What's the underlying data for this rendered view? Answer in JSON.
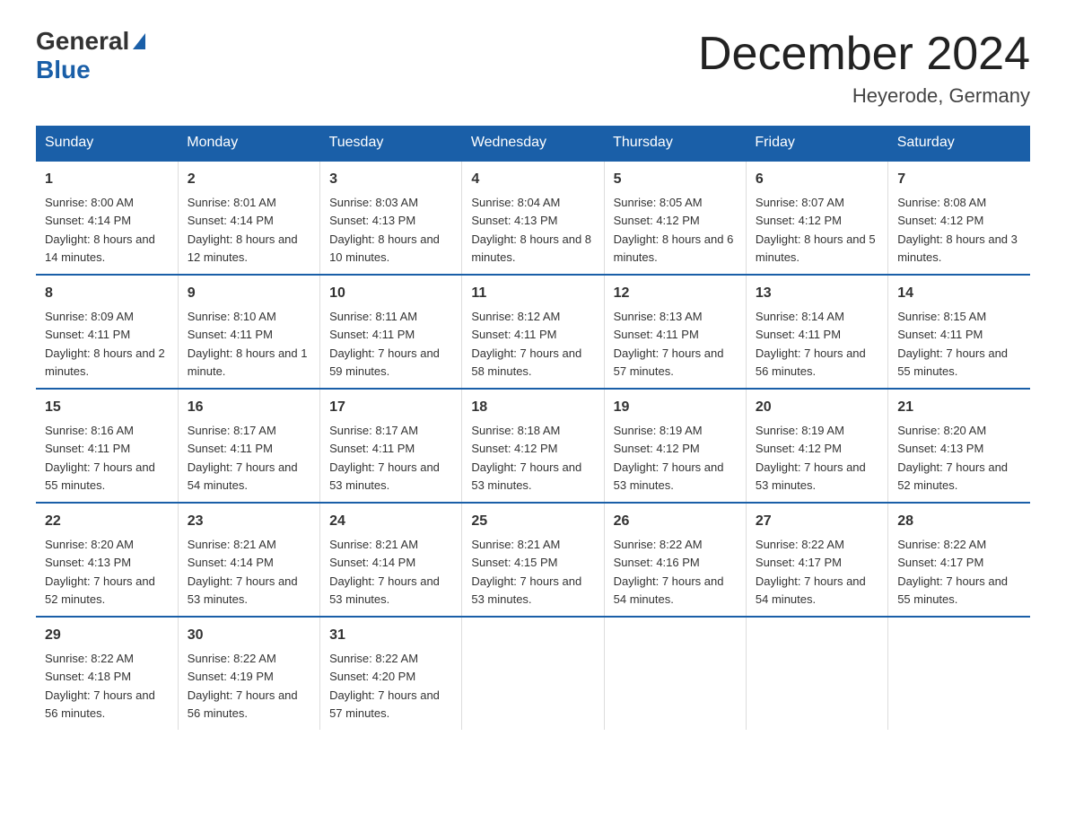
{
  "header": {
    "logo_general": "General",
    "logo_blue": "Blue",
    "main_title": "December 2024",
    "subtitle": "Heyerode, Germany"
  },
  "days_of_week": [
    "Sunday",
    "Monday",
    "Tuesday",
    "Wednesday",
    "Thursday",
    "Friday",
    "Saturday"
  ],
  "weeks": [
    [
      {
        "day": "1",
        "sunrise": "8:00 AM",
        "sunset": "4:14 PM",
        "daylight": "8 hours and 14 minutes."
      },
      {
        "day": "2",
        "sunrise": "8:01 AM",
        "sunset": "4:14 PM",
        "daylight": "8 hours and 12 minutes."
      },
      {
        "day": "3",
        "sunrise": "8:03 AM",
        "sunset": "4:13 PM",
        "daylight": "8 hours and 10 minutes."
      },
      {
        "day": "4",
        "sunrise": "8:04 AM",
        "sunset": "4:13 PM",
        "daylight": "8 hours and 8 minutes."
      },
      {
        "day": "5",
        "sunrise": "8:05 AM",
        "sunset": "4:12 PM",
        "daylight": "8 hours and 6 minutes."
      },
      {
        "day": "6",
        "sunrise": "8:07 AM",
        "sunset": "4:12 PM",
        "daylight": "8 hours and 5 minutes."
      },
      {
        "day": "7",
        "sunrise": "8:08 AM",
        "sunset": "4:12 PM",
        "daylight": "8 hours and 3 minutes."
      }
    ],
    [
      {
        "day": "8",
        "sunrise": "8:09 AM",
        "sunset": "4:11 PM",
        "daylight": "8 hours and 2 minutes."
      },
      {
        "day": "9",
        "sunrise": "8:10 AM",
        "sunset": "4:11 PM",
        "daylight": "8 hours and 1 minute."
      },
      {
        "day": "10",
        "sunrise": "8:11 AM",
        "sunset": "4:11 PM",
        "daylight": "7 hours and 59 minutes."
      },
      {
        "day": "11",
        "sunrise": "8:12 AM",
        "sunset": "4:11 PM",
        "daylight": "7 hours and 58 minutes."
      },
      {
        "day": "12",
        "sunrise": "8:13 AM",
        "sunset": "4:11 PM",
        "daylight": "7 hours and 57 minutes."
      },
      {
        "day": "13",
        "sunrise": "8:14 AM",
        "sunset": "4:11 PM",
        "daylight": "7 hours and 56 minutes."
      },
      {
        "day": "14",
        "sunrise": "8:15 AM",
        "sunset": "4:11 PM",
        "daylight": "7 hours and 55 minutes."
      }
    ],
    [
      {
        "day": "15",
        "sunrise": "8:16 AM",
        "sunset": "4:11 PM",
        "daylight": "7 hours and 55 minutes."
      },
      {
        "day": "16",
        "sunrise": "8:17 AM",
        "sunset": "4:11 PM",
        "daylight": "7 hours and 54 minutes."
      },
      {
        "day": "17",
        "sunrise": "8:17 AM",
        "sunset": "4:11 PM",
        "daylight": "7 hours and 53 minutes."
      },
      {
        "day": "18",
        "sunrise": "8:18 AM",
        "sunset": "4:12 PM",
        "daylight": "7 hours and 53 minutes."
      },
      {
        "day": "19",
        "sunrise": "8:19 AM",
        "sunset": "4:12 PM",
        "daylight": "7 hours and 53 minutes."
      },
      {
        "day": "20",
        "sunrise": "8:19 AM",
        "sunset": "4:12 PM",
        "daylight": "7 hours and 53 minutes."
      },
      {
        "day": "21",
        "sunrise": "8:20 AM",
        "sunset": "4:13 PM",
        "daylight": "7 hours and 52 minutes."
      }
    ],
    [
      {
        "day": "22",
        "sunrise": "8:20 AM",
        "sunset": "4:13 PM",
        "daylight": "7 hours and 52 minutes."
      },
      {
        "day": "23",
        "sunrise": "8:21 AM",
        "sunset": "4:14 PM",
        "daylight": "7 hours and 53 minutes."
      },
      {
        "day": "24",
        "sunrise": "8:21 AM",
        "sunset": "4:14 PM",
        "daylight": "7 hours and 53 minutes."
      },
      {
        "day": "25",
        "sunrise": "8:21 AM",
        "sunset": "4:15 PM",
        "daylight": "7 hours and 53 minutes."
      },
      {
        "day": "26",
        "sunrise": "8:22 AM",
        "sunset": "4:16 PM",
        "daylight": "7 hours and 54 minutes."
      },
      {
        "day": "27",
        "sunrise": "8:22 AM",
        "sunset": "4:17 PM",
        "daylight": "7 hours and 54 minutes."
      },
      {
        "day": "28",
        "sunrise": "8:22 AM",
        "sunset": "4:17 PM",
        "daylight": "7 hours and 55 minutes."
      }
    ],
    [
      {
        "day": "29",
        "sunrise": "8:22 AM",
        "sunset": "4:18 PM",
        "daylight": "7 hours and 56 minutes."
      },
      {
        "day": "30",
        "sunrise": "8:22 AM",
        "sunset": "4:19 PM",
        "daylight": "7 hours and 56 minutes."
      },
      {
        "day": "31",
        "sunrise": "8:22 AM",
        "sunset": "4:20 PM",
        "daylight": "7 hours and 57 minutes."
      },
      null,
      null,
      null,
      null
    ]
  ],
  "labels": {
    "sunrise": "Sunrise:",
    "sunset": "Sunset:",
    "daylight": "Daylight:"
  }
}
